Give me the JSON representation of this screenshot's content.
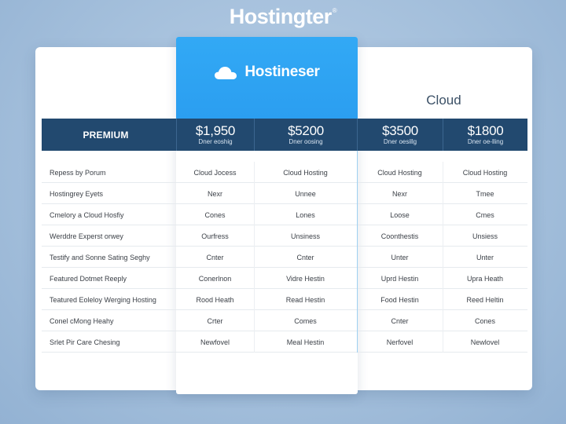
{
  "brand": {
    "name": "Hostingter",
    "mark": "®"
  },
  "featured": {
    "title": "Hostineser",
    "icon": "cloud-icon"
  },
  "cloud_label": "Cloud",
  "pricing": {
    "tier_label": "PREMIUM",
    "columns": [
      {
        "amount": "$1,950",
        "sub": "Dner eoshig"
      },
      {
        "amount": "$5200",
        "sub": "Dner oosing"
      },
      {
        "amount": "$3500",
        "sub": "Dner oesillg"
      },
      {
        "amount": "$1800",
        "sub": "Dner oe-lling"
      }
    ]
  },
  "rows": [
    {
      "label": "Repess by Porum",
      "values": [
        "Cloud Jocess",
        "Cloud Hosting",
        "Cloud Hosting",
        "Cloud Hosting"
      ]
    },
    {
      "label": "Hostingrey Eyets",
      "values": [
        "Nexr",
        "Unnee",
        "Nexr",
        "Tmee"
      ]
    },
    {
      "label": "Cmelory a Cloud Hosfiy",
      "values": [
        "Cones",
        "Lones",
        "Loose",
        "Cmes"
      ]
    },
    {
      "label": "Werddre Experst orwey",
      "values": [
        "Ourfress",
        "Unsiness",
        "Coonthestis",
        "Unsiess"
      ]
    },
    {
      "label": "Testify and Sonne Sating Seghy",
      "values": [
        "Cnter",
        "Cnter",
        "Unter",
        "Unter"
      ]
    },
    {
      "label": "Featured Dotmet Reeply",
      "values": [
        "Conerlnon",
        "Vidre Hestin",
        "Uprd Hestin",
        "Upra Heath"
      ]
    },
    {
      "label": "Teatured Eoleloy Werging Hosting",
      "values": [
        "Rood Heath",
        "Read Hestin",
        "Food Hestin",
        "Reed Heltin"
      ]
    },
    {
      "label": "Conel cMong Heahy",
      "values": [
        "Crter",
        "Comes",
        "Cnter",
        "Cones"
      ]
    },
    {
      "label": "Srlet Pir Care Chesing",
      "values": [
        "Newfovel",
        "Meal Hestin",
        "Nerfovel",
        "Newlovel"
      ]
    }
  ]
}
